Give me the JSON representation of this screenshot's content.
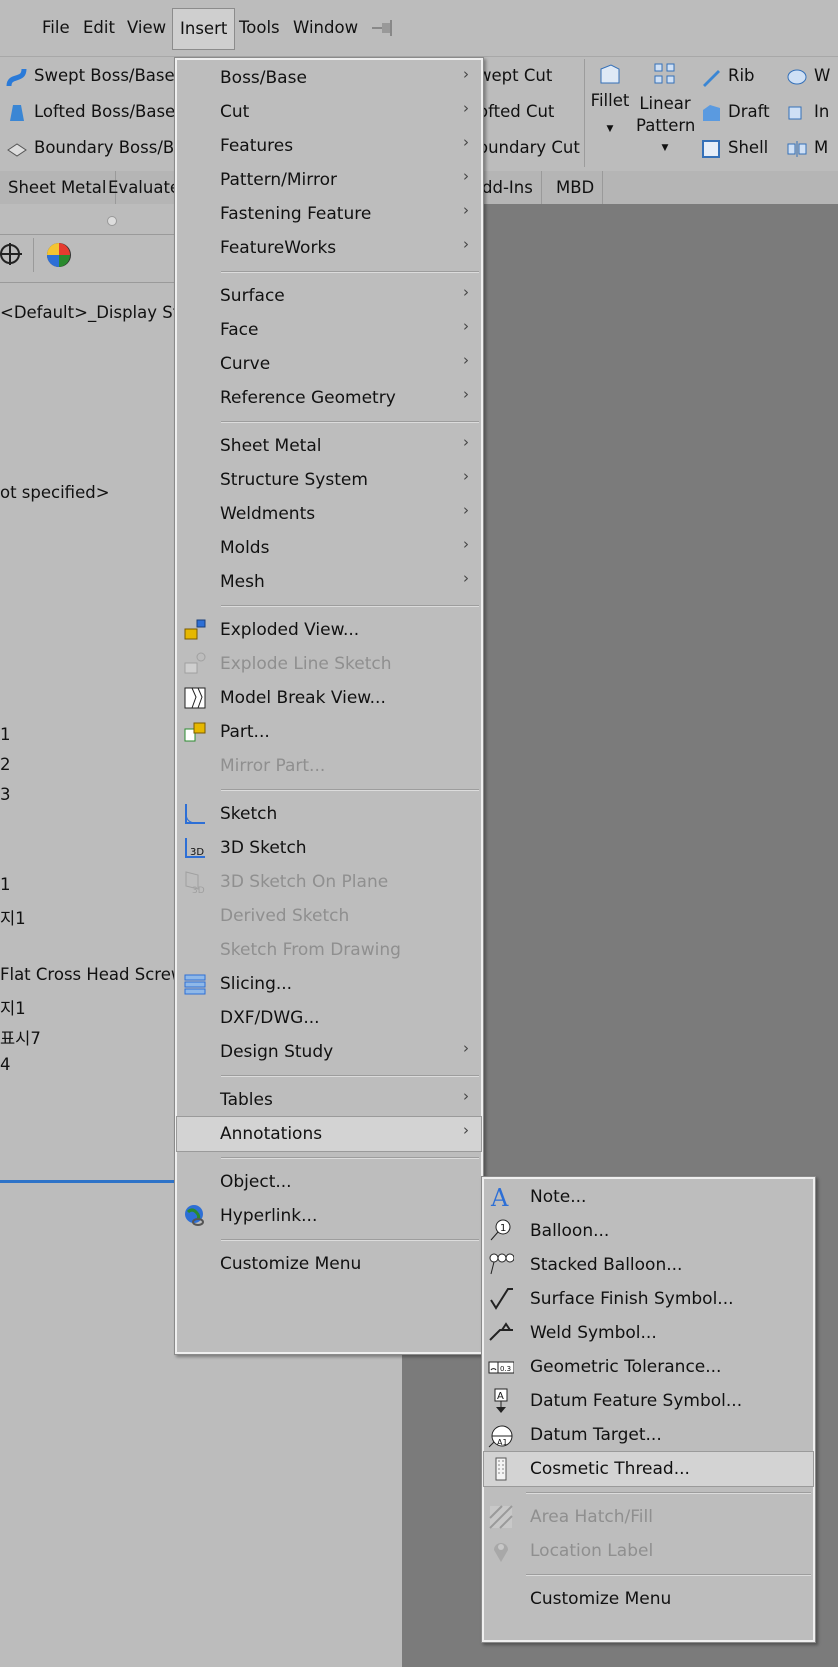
{
  "menubar": {
    "items": [
      "File",
      "Edit",
      "View",
      "Insert",
      "Tools",
      "Window"
    ],
    "pin_icon": "pin-icon"
  },
  "ribbon": {
    "left": [
      "Swept Boss/Base",
      "Lofted Boss/Base",
      "Boundary Boss/B"
    ],
    "mid": [
      "wept Cut",
      "ofted Cut",
      "oundary Cut"
    ],
    "fillet": "Fillet",
    "linear_pattern": [
      "Linear",
      "Pattern"
    ],
    "right": [
      "Rib",
      "Draft",
      "Shell"
    ],
    "far_right": [
      "W",
      "In",
      "M"
    ]
  },
  "tabs": [
    "Sheet Metal",
    "Evaluate",
    "dd-Ins",
    "MBD"
  ],
  "tree": {
    "display_state": "<Default>_Display Sta",
    "material": "ot specified>",
    "items": [
      "1",
      "2",
      "3",
      "1",
      "지1",
      "Flat Cross Head Screw",
      "지1",
      "표시7",
      "4"
    ]
  },
  "insert_menu": {
    "groups": [
      [
        {
          "label": "Boss/Base",
          "submenu": true
        },
        {
          "label": "Cut",
          "submenu": true
        },
        {
          "label": "Features",
          "submenu": true
        },
        {
          "label": "Pattern/Mirror",
          "submenu": true
        },
        {
          "label": "Fastening Feature",
          "submenu": true
        },
        {
          "label": "FeatureWorks",
          "submenu": true
        }
      ],
      [
        {
          "label": "Surface",
          "submenu": true
        },
        {
          "label": "Face",
          "submenu": true
        },
        {
          "label": "Curve",
          "submenu": true
        },
        {
          "label": "Reference Geometry",
          "submenu": true
        }
      ],
      [
        {
          "label": "Sheet Metal",
          "submenu": true
        },
        {
          "label": "Structure System",
          "submenu": true
        },
        {
          "label": "Weldments",
          "submenu": true
        },
        {
          "label": "Molds",
          "submenu": true
        },
        {
          "label": "Mesh",
          "submenu": true
        }
      ],
      [
        {
          "label": "Exploded View...",
          "icon": "exploded-view-icon"
        },
        {
          "label": "Explode Line Sketch",
          "icon": "explode-line-sketch-icon",
          "disabled": true
        },
        {
          "label": "Model Break View...",
          "icon": "model-break-view-icon"
        },
        {
          "label": "Part...",
          "icon": "part-icon"
        },
        {
          "label": "Mirror Part...",
          "disabled": true
        }
      ],
      [
        {
          "label": "Sketch",
          "icon": "sketch-icon"
        },
        {
          "label": "3D Sketch",
          "icon": "3d-sketch-icon"
        },
        {
          "label": "3D Sketch On Plane",
          "icon": "3d-sketch-on-plane-icon",
          "disabled": true
        },
        {
          "label": "Derived Sketch",
          "disabled": true
        },
        {
          "label": "Sketch From Drawing",
          "disabled": true
        },
        {
          "label": "Slicing...",
          "icon": "slicing-icon"
        },
        {
          "label": "DXF/DWG..."
        },
        {
          "label": "Design Study",
          "submenu": true
        }
      ],
      [
        {
          "label": "Tables",
          "submenu": true
        },
        {
          "label": "Annotations",
          "submenu": true,
          "highlight": true
        }
      ],
      [
        {
          "label": "Object..."
        },
        {
          "label": "Hyperlink...",
          "icon": "hyperlink-icon"
        }
      ],
      [
        {
          "label": "Customize Menu"
        }
      ]
    ]
  },
  "annotations_menu": {
    "groups": [
      [
        {
          "label": "Note...",
          "icon": "note-icon"
        },
        {
          "label": "Balloon...",
          "icon": "balloon-icon"
        },
        {
          "label": "Stacked Balloon...",
          "icon": "stacked-balloon-icon"
        },
        {
          "label": "Surface Finish Symbol...",
          "icon": "surface-finish-icon"
        },
        {
          "label": "Weld Symbol...",
          "icon": "weld-symbol-icon"
        },
        {
          "label": "Geometric Tolerance...",
          "icon": "geometric-tolerance-icon"
        },
        {
          "label": "Datum Feature Symbol...",
          "icon": "datum-feature-icon"
        },
        {
          "label": "Datum Target...",
          "icon": "datum-target-icon"
        },
        {
          "label": "Cosmetic Thread...",
          "icon": "cosmetic-thread-icon",
          "highlight": true
        }
      ],
      [
        {
          "label": "Area Hatch/Fill",
          "icon": "area-hatch-icon",
          "disabled": true
        },
        {
          "label": "Location Label",
          "icon": "location-label-icon",
          "disabled": true
        }
      ],
      [
        {
          "label": "Customize Menu"
        }
      ]
    ]
  }
}
